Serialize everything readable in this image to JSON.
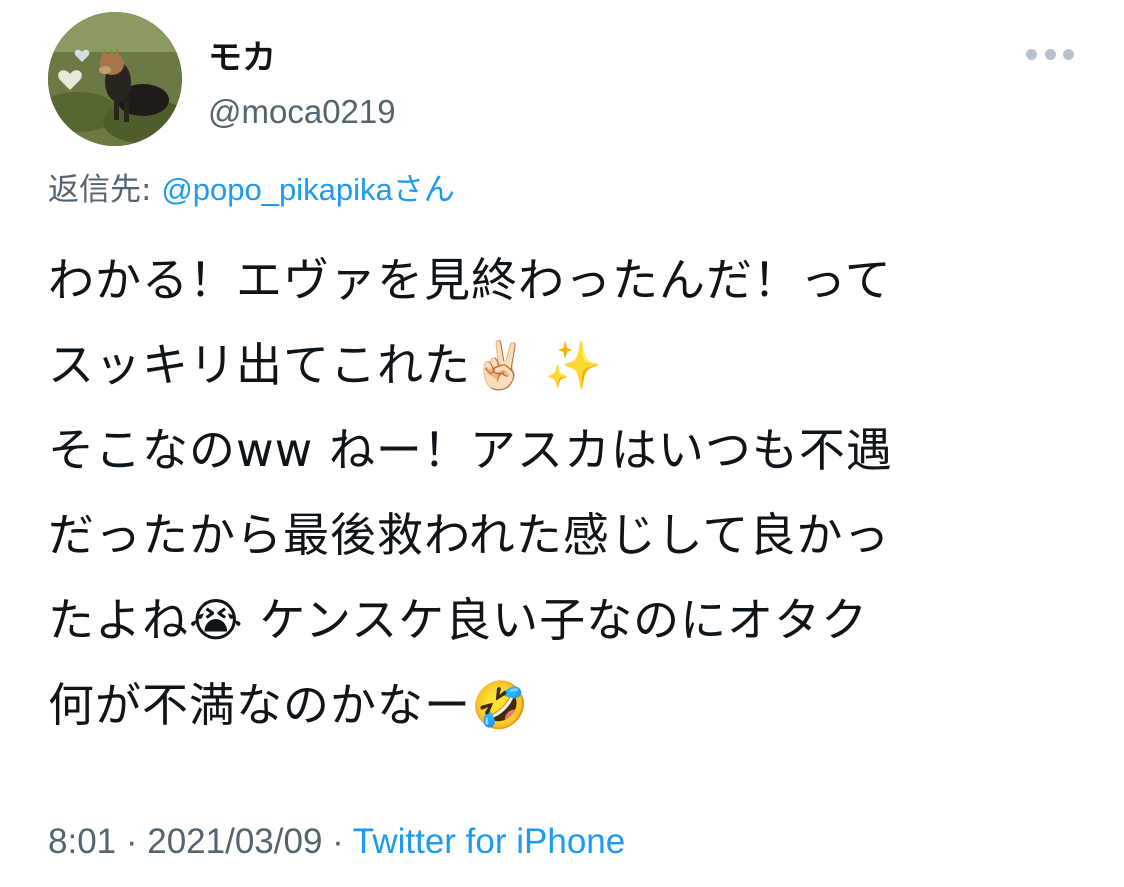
{
  "user": {
    "display_name": "モカ",
    "handle": "@moca0219"
  },
  "reply": {
    "prefix": "返信先: ",
    "mention": "@popo_pikapika",
    "suffix": "さん"
  },
  "tweet": {
    "lines": [
      "わかる！エヴァを見終わったんだ！って",
      "スッキリ出てこれた✌🏻 ✨",
      "そこなのww ねー！アスカはいつも不遇",
      "だったから最後救われた感じして良かっ",
      "たよね😭 ケンスケ良い子なのにオタク",
      "何が不満なのかなー🤣"
    ]
  },
  "meta": {
    "time": "8:01",
    "separator1": " · ",
    "date": "2021/03/09",
    "separator2": " · ",
    "source": "Twitter for iPhone"
  },
  "icons": {
    "more": "more-horizontal-icon",
    "avatar": "avatar-image"
  },
  "colors": {
    "link": "#1d9bf0",
    "secondary_text": "#536471",
    "primary_text": "#0f1419"
  }
}
